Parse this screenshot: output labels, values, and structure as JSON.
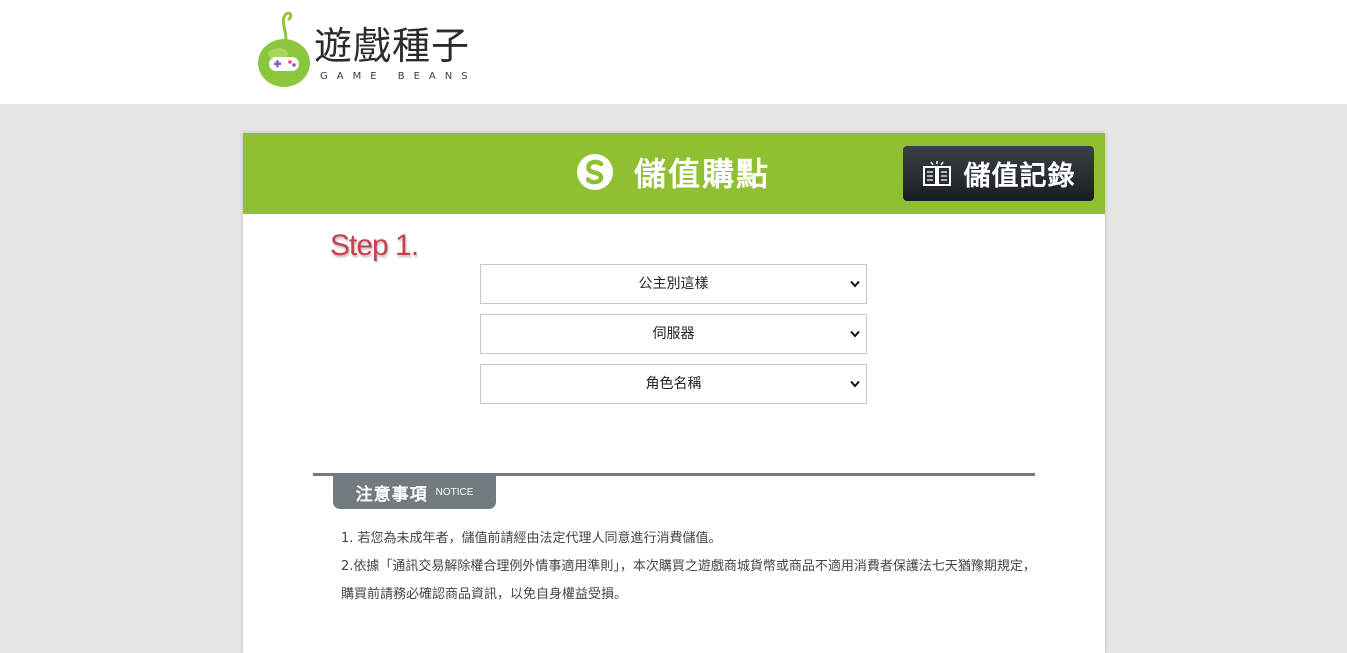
{
  "brand": {
    "title": "遊戲種子",
    "subtitle": "GAME BEANS"
  },
  "header": {
    "title": "儲值購點",
    "record_button": "儲值記錄"
  },
  "step": {
    "label": "Step 1."
  },
  "selects": {
    "game": "公主別這樣",
    "server": "伺服器",
    "character": "角色名稱"
  },
  "notice": {
    "title": "注意事項",
    "subtitle": "NOTICE",
    "items": [
      "1. 若您為未成年者，儲值前請經由法定代理人同意進行消費儲值。",
      "2.依據「通訊交易解除權合理例外情事適用準則」，本次購買之遊戲商城貨幣或商品不適用消費者保護法七天猶豫期規定，購買前請務必確認商品資訊，以免自身權益受損。"
    ]
  },
  "colors": {
    "accent_green": "#8fc031",
    "dark_button": "#1e2226",
    "notice_gray": "#727b80",
    "step_red": "#c9404a"
  }
}
